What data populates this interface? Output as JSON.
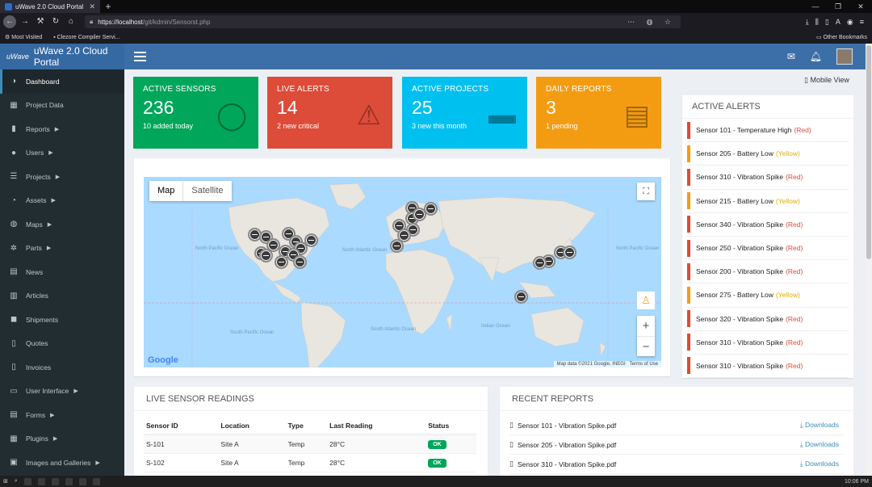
{
  "browser": {
    "tab_title": "uWave 2.0 Cloud Portal",
    "tab_close": "✕",
    "new_tab": "+",
    "url_host": "https://localhost",
    "url_path": "/git/kdmin/Sensorst.php",
    "bookmark_most_visited": "Most Visited",
    "bookmark_clezore": "Clezore Compiler Servi...",
    "bookmark_other": "Other Bookmarks"
  },
  "app": {
    "logo_mark": "uWave",
    "title": "uWave 2.0 Cloud Portal"
  },
  "sidebar": {
    "items": [
      {
        "label": "Dashboard",
        "icon": "palette-icon",
        "glyph": "◑",
        "chevron": false
      },
      {
        "label": "Project Data",
        "icon": "table-icon",
        "glyph": "▦",
        "chevron": false
      },
      {
        "label": "Reports",
        "icon": "bar-chart-icon",
        "glyph": "▮",
        "chevron": true
      },
      {
        "label": "Users",
        "icon": "user-icon",
        "glyph": "●",
        "chevron": true
      },
      {
        "label": "Projects",
        "icon": "database-icon",
        "glyph": "☰",
        "chevron": true
      },
      {
        "label": "Assets",
        "icon": "gauge-icon",
        "glyph": "◔",
        "chevron": true
      },
      {
        "label": "Maps",
        "icon": "globe-icon",
        "glyph": "◍",
        "chevron": true
      },
      {
        "label": "Parts",
        "icon": "cogs-icon",
        "glyph": "✲",
        "chevron": true
      },
      {
        "label": "News",
        "icon": "newspaper-icon",
        "glyph": "▤",
        "chevron": false
      },
      {
        "label": "Articles",
        "icon": "list-icon",
        "glyph": "▥",
        "chevron": false
      },
      {
        "label": "Shipments",
        "icon": "truck-icon",
        "glyph": "◼",
        "chevron": false
      },
      {
        "label": "Quotes",
        "icon": "file-icon",
        "glyph": "▯",
        "chevron": false
      },
      {
        "label": "Invoices",
        "icon": "invoice-icon",
        "glyph": "▯",
        "chevron": false
      },
      {
        "label": "User Interface",
        "icon": "laptop-icon",
        "glyph": "▭",
        "chevron": true
      },
      {
        "label": "Forms",
        "icon": "edit-icon",
        "glyph": "▤",
        "chevron": true
      },
      {
        "label": "Plugins",
        "icon": "grid-icon",
        "glyph": "▦",
        "chevron": true
      },
      {
        "label": "Images and Galleries",
        "icon": "image-icon",
        "glyph": "▣",
        "chevron": true
      }
    ]
  },
  "stats": {
    "sensors": {
      "label": "ACTIVE SENSORS",
      "value": "236",
      "sub": "10 added today"
    },
    "alerts": {
      "label": "LIVE ALERTS",
      "value": "14",
      "sub": "2 new critical"
    },
    "projects": {
      "label": "ACTIVE PROJECTS",
      "value": "25",
      "sub": "3 new this month"
    },
    "reports": {
      "label": "DAILY REPORTS",
      "value": "3",
      "sub": "1 pending"
    }
  },
  "mobile_view": "Mobile View",
  "map": {
    "tab_map": "Map",
    "tab_satellite": "Satellite",
    "attribution": "Map data ©2021 Google, INEGI",
    "terms": "Terms of Use",
    "google": "Google",
    "labels": {
      "north_pacific": "North Pacific Ocean",
      "north_pacific_2": "North Pacific Ocean",
      "north_atlantic": "North Atlantic Ocean",
      "south_pacific": "South Pacific Ocean",
      "south_atlantic": "South Atlantic Ocean",
      "indian": "Indian Ocean"
    }
  },
  "active_alerts": {
    "title": "ACTIVE ALERTS",
    "items": [
      {
        "text": "Sensor 101 - Temperature High",
        "severity": "(Red)",
        "level": "red"
      },
      {
        "text": "Sensor 205 - Battery Low",
        "severity": "(Yellow)",
        "level": "yellow"
      },
      {
        "text": "Sensor 310 - Vibration Spike",
        "severity": "(Red)",
        "level": "red"
      },
      {
        "text": "Sensor 215 - Battery Low",
        "severity": "(Yellow)",
        "level": "yellow"
      },
      {
        "text": "Sensor 340 - Vibration Spike",
        "severity": "(Red)",
        "level": "red"
      },
      {
        "text": "Sensor 250 - Vibration Spike",
        "severity": "(Red)",
        "level": "red"
      },
      {
        "text": "Sensor 200 - Vibration Spike",
        "severity": "(Red)",
        "level": "red"
      },
      {
        "text": "Sensor 275 - Battery Low",
        "severity": "(Yellow)",
        "level": "yellow"
      },
      {
        "text": "Sensor 320 - Vibration Spike",
        "severity": "(Red)",
        "level": "red"
      },
      {
        "text": "Sensor 310 - Vibration Spike",
        "severity": "(Red)",
        "level": "red"
      },
      {
        "text": "Sensor 310 - Vibration Spike",
        "severity": "(Red)",
        "level": "red"
      }
    ]
  },
  "live_readings": {
    "title": "LIVE SENSOR READINGS",
    "columns": [
      "Sensor ID",
      "Location",
      "Type",
      "Last Reading",
      "Status"
    ],
    "rows": [
      [
        "S-101",
        "Site A",
        "Temp",
        "28°C",
        "OK"
      ],
      [
        "S-102",
        "Site A",
        "Temp",
        "28°C",
        "OK"
      ]
    ]
  },
  "recent_reports": {
    "title": "RECENT REPORTS",
    "download_label": "Downloads",
    "items": [
      "Sensor 101 - Vibration Spike.pdf",
      "Sensor 205 - Vibration Spike.pdf",
      "Sensor 310 - Vibration Spike.pdf"
    ]
  },
  "taskbar": {
    "time": "10:06 PM"
  },
  "colors": {
    "header": "#3c6fa8",
    "sidebar": "#222d32",
    "green": "#00a65a",
    "red": "#dd4b39",
    "aqua": "#00c0ef",
    "yellow": "#f39c12"
  }
}
